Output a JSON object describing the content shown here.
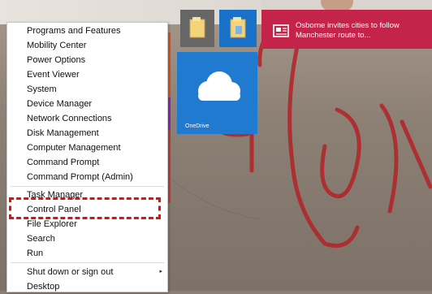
{
  "context_menu": {
    "items": [
      {
        "label": "Programs and Features"
      },
      {
        "label": "Mobility Center"
      },
      {
        "label": "Power Options"
      },
      {
        "label": "Event Viewer"
      },
      {
        "label": "System"
      },
      {
        "label": "Device Manager"
      },
      {
        "label": "Network Connections"
      },
      {
        "label": "Disk Management"
      },
      {
        "label": "Computer Management"
      },
      {
        "label": "Command Prompt"
      },
      {
        "label": "Command Prompt (Admin)"
      },
      {
        "label": "Task Manager"
      },
      {
        "label": "Control Panel"
      },
      {
        "label": "File Explorer"
      },
      {
        "label": "Search"
      },
      {
        "label": "Run"
      },
      {
        "label": "Shut down or sign out"
      },
      {
        "label": "Desktop"
      }
    ],
    "submenu_arrow": "▸"
  },
  "tiles": {
    "onedrive_label": "OneDrive",
    "news_line1": "Osborne invites cities to follow",
    "news_line2": "Manchester route to..."
  },
  "colors": {
    "highlight": "#e01010",
    "onedrive_tile": "#1f7ad0",
    "news_tile": "#c4244a",
    "folder_tile": "#1a71c8"
  },
  "icons": {
    "folder": "folder-icon",
    "onedrive": "cloud-icon",
    "news": "news-icon",
    "submenu": "chevron-right-icon"
  }
}
